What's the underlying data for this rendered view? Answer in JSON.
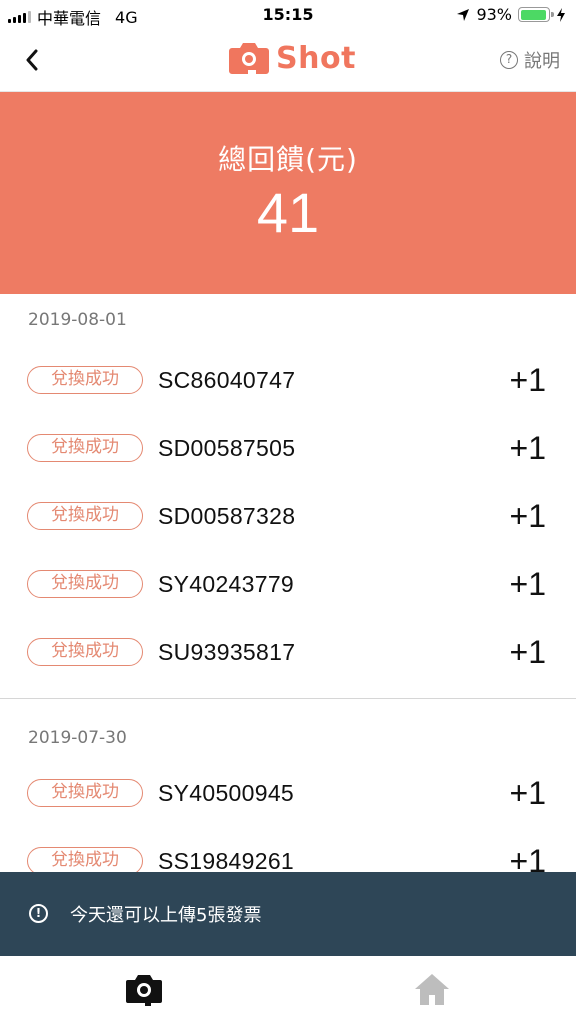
{
  "status_bar": {
    "carrier": "中華電信",
    "network": "4G",
    "time": "15:15",
    "battery_percent_text": "93%",
    "battery_level": 0.93
  },
  "nav": {
    "back_icon": "chevron-left-icon",
    "logo_text": "Shot",
    "help_label": "說明"
  },
  "summary": {
    "label": "總回饋(元)",
    "value": "41"
  },
  "groups": [
    {
      "date": "2019-08-01",
      "items": [
        {
          "status": "兌換成功",
          "code": "SC86040747",
          "amount": "+1"
        },
        {
          "status": "兌換成功",
          "code": "SD00587505",
          "amount": "+1"
        },
        {
          "status": "兌換成功",
          "code": "SD00587328",
          "amount": "+1"
        },
        {
          "status": "兌換成功",
          "code": "SY40243779",
          "amount": "+1"
        },
        {
          "status": "兌換成功",
          "code": "SU93935817",
          "amount": "+1"
        }
      ]
    },
    {
      "date": "2019-07-30",
      "items": [
        {
          "status": "兌換成功",
          "code": "SY40500945",
          "amount": "+1"
        },
        {
          "status": "兌換成功",
          "code": "SS19849261",
          "amount": "+1"
        }
      ]
    }
  ],
  "notice": {
    "text": "今天還可以上傳5張發票"
  },
  "tabbar": {
    "tabs": [
      {
        "icon": "camera-icon",
        "active": true
      },
      {
        "icon": "home-icon",
        "active": false
      }
    ]
  },
  "colors": {
    "brand": "#ee7b63",
    "badge": "#e48972",
    "notice_bg": "#2e4657",
    "battery": "#4cd964"
  }
}
